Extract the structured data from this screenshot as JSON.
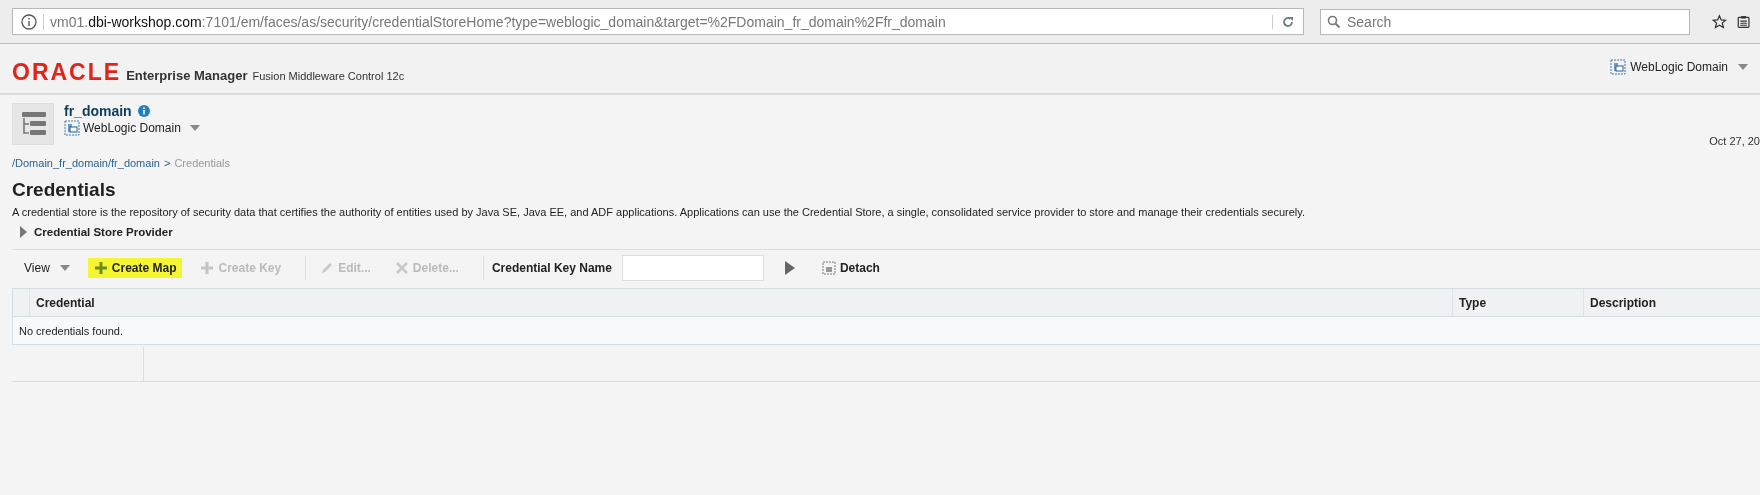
{
  "browser": {
    "url_host_prefix": "vm01.",
    "url_host": "dbi-workshop.com",
    "url_rest": ":7101/em/faces/as/security/credentialStoreHome?type=weblogic_domain&target=%2FDomain_fr_domain%2Ffr_domain",
    "search": {
      "placeholder": "Search"
    }
  },
  "header": {
    "logo": "ORACLE",
    "product": "Enterprise Manager",
    "subtitle": "Fusion Middleware Control 12c",
    "target_menu": "WebLogic Domain"
  },
  "target": {
    "name": "fr_domain",
    "type": "WebLogic Domain",
    "date": "Oct 27, 20"
  },
  "breadcrumb": {
    "link": "/Domain_fr_domain/fr_domain",
    "separator": ">",
    "current": "Credentials"
  },
  "page": {
    "title": "Credentials",
    "description": "A credential store is the repository of security data that certifies the authority of entities used by Java SE, Java EE, and ADF applications. Applications can use the Credential Store, a single, consolidated service provider to store and manage their credentials securely."
  },
  "section": {
    "label": "Credential Store Provider",
    "expanded": false
  },
  "toolbar": {
    "items": [
      {
        "kind": "menu",
        "label": "View",
        "disabled": false,
        "highlighted": false
      },
      {
        "kind": "add",
        "label": "Create Map",
        "disabled": false,
        "highlighted": true
      },
      {
        "kind": "add",
        "label": "Create Key",
        "disabled": true,
        "highlighted": false
      },
      {
        "kind": "edit",
        "label": "Edit...",
        "disabled": true,
        "highlighted": false
      },
      {
        "kind": "delete",
        "label": "Delete...",
        "disabled": true,
        "highlighted": false
      }
    ],
    "filter_label": "Credential Key Name",
    "detach": "Detach"
  },
  "table": {
    "columns": [
      "Credential",
      "Type",
      "Description"
    ],
    "empty_message": "No credentials found."
  }
}
